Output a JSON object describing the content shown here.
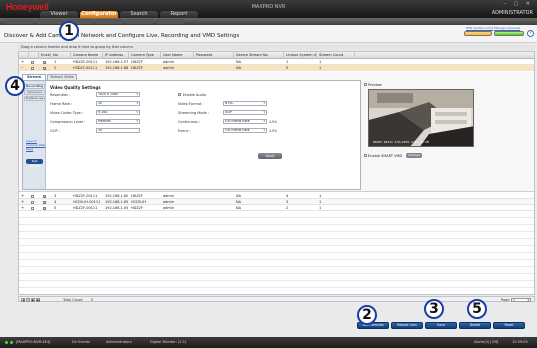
{
  "titlebar": {
    "logo": "Honeywell",
    "app_title": "MAXPRO NVR",
    "user": "ADMINISTRATOR",
    "window_controls": "– ▢ ✕"
  },
  "nav": {
    "tabs": [
      {
        "label": "Viewer",
        "active": false
      },
      {
        "label": "Configurator",
        "active": true
      },
      {
        "label": "Search",
        "active": false
      },
      {
        "label": "Report",
        "active": false
      }
    ]
  },
  "page": {
    "title": "Discover & Add Cameras in Network and Configure Live, Recording and VMD Settings",
    "link_left": "NVR System Limit",
    "link_right": "Manage Cameras",
    "help_label": "?"
  },
  "hint": "Drag a column header and drop it here to group by that column",
  "table": {
    "columns": [
      "",
      "Enable",
      "No",
      "Camera Name",
      "IP Address",
      "Camera Type",
      "User Name",
      "Password",
      "Device Stream No.",
      "Unique System Id",
      "Stream Count"
    ],
    "rows": [
      {
        "expander": "+",
        "checked": false,
        "enable": true,
        "no": "1",
        "name": "HDZ2F-00111",
        "ip": "192.168.1.57",
        "type": "HDZ2F",
        "user": "admin",
        "password": "",
        "stream": "NA",
        "uid": "1",
        "count": "1",
        "selected": false
      },
      {
        "expander": "–",
        "checked": false,
        "enable": true,
        "no": "2",
        "name": "H3D2F-00111",
        "ip": "192.168.1.88",
        "type": "HDZ2F",
        "user": "admin",
        "password": "",
        "stream": "NA",
        "uid": "5",
        "count": "1",
        "selected": true
      }
    ],
    "rows_after": [
      {
        "expander": "+",
        "checked": false,
        "enable": true,
        "no": "3",
        "name": "HDZ2F-00111",
        "ip": "192.168.1.60",
        "type": "HDZ2F",
        "user": "admin",
        "password": "",
        "stream": "NA",
        "uid": "4",
        "count": "1"
      },
      {
        "expander": "+",
        "checked": false,
        "enable": true,
        "no": "4",
        "name": "HCD5-IH-00111",
        "ip": "192.168.1.65",
        "type": "HCD5-IH",
        "user": "admin",
        "password": "",
        "stream": "NA",
        "uid": "3",
        "count": "1"
      },
      {
        "expander": "+",
        "checked": false,
        "enable": true,
        "no": "5",
        "name": "HDZ2F-00111",
        "ip": "192.168.1.55",
        "type": "HDZ2F",
        "user": "admin",
        "password": "",
        "stream": "NA",
        "uid": "2",
        "count": "1"
      }
    ]
  },
  "detail": {
    "tabs": [
      "Stream",
      "Stream Video"
    ],
    "nav_items": [
      "Recording",
      "Advanced",
      "Preferences"
    ],
    "links": [
      "Launch Camera Web Page"
    ],
    "nav_button": "Test Camera",
    "section_title": "Video Quality Settings",
    "fields_left": [
      {
        "label": "Resolution :",
        "value": "1920 x 1080"
      },
      {
        "label": "Frame Rate :",
        "value": "30"
      },
      {
        "label": "Video Codec Type :",
        "value": "H.264"
      },
      {
        "label": "Compression Level :",
        "value": "Medium"
      },
      {
        "label": "GOP :",
        "value": "30"
      }
    ],
    "fields_right": [
      {
        "label": "Enable Audio",
        "value": ""
      },
      {
        "label": "Video Format :",
        "value": "NTSC"
      },
      {
        "label": "Streaming Mode :",
        "value": "UDP"
      },
      {
        "label": "Continuous :",
        "value": "Full Frame Rate",
        "pct": "4.9%"
      },
      {
        "label": "Event :",
        "value": "Full Frame Rate",
        "pct": "4.9%"
      }
    ],
    "apply_label": "Apply",
    "preview": {
      "label": "Preview",
      "timestamp": "HDZ2F-00111 5/6/2015 4:41:33 PM",
      "smart_label": "Enable SMART VMD",
      "smart_button": "Settings"
    }
  },
  "pager": {
    "buttons": [
      "◀",
      "1",
      "▶",
      "▶|"
    ],
    "total_label": "Total Count",
    "total": "5",
    "page_label": "Page",
    "page_value": "1"
  },
  "actions": [
    "Add Cameras",
    "Reboot Cam",
    "Save",
    "Delete",
    "Reset"
  ],
  "status": {
    "server": "[MAXPRO-NVR-XE4]",
    "user": "Dir Events",
    "group": "Administrators",
    "license": "Digital Monitor: (2.1)",
    "alarms": "Alarm(0) [Off]",
    "time": "12:59:05"
  },
  "callouts": [
    "1",
    "2",
    "3",
    "4",
    "5"
  ],
  "colors": {
    "brand_red": "#e01b22",
    "active_tab": "#f2a33a",
    "selected_row": "#fbe2bb",
    "action_blue": "#1f4f8f"
  }
}
